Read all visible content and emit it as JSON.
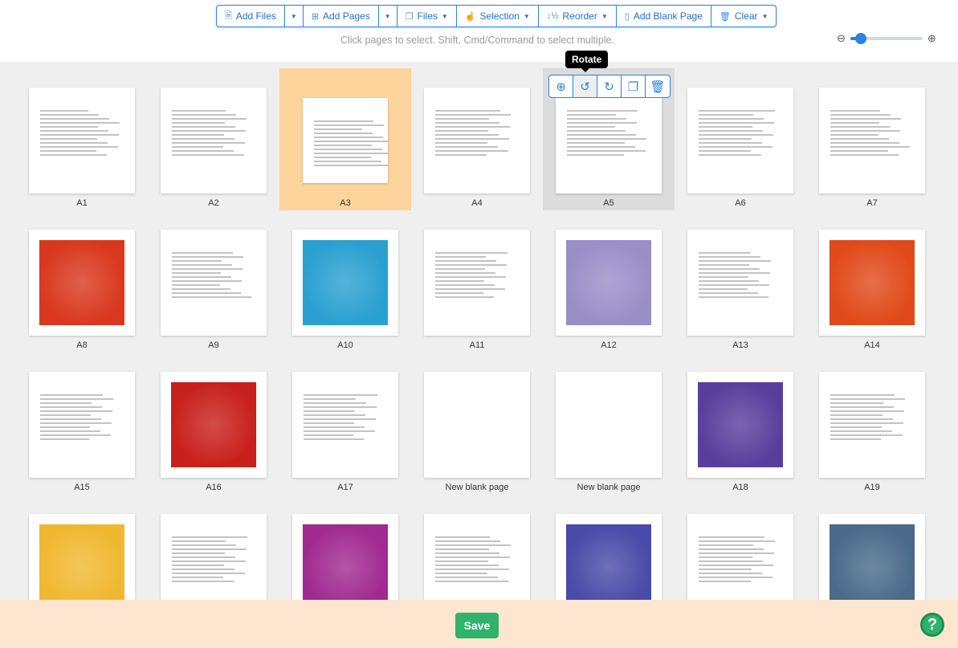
{
  "toolbar": {
    "add_files": "Add Files",
    "add_pages": "Add Pages",
    "files": "Files",
    "selection": "Selection",
    "reorder": "Reorder",
    "add_blank": "Add Blank Page",
    "clear": "Clear"
  },
  "hint": "Click pages to select. Shift, Cmd/Command to select multiple.",
  "zoom_level_percent": 15,
  "tooltip": "Rotate",
  "page_actions": [
    "zoom-in",
    "rotate-left",
    "rotate-right",
    "duplicate",
    "delete"
  ],
  "pages": [
    {
      "label": "A1",
      "type": "text"
    },
    {
      "label": "A2",
      "type": "text"
    },
    {
      "label": "A3",
      "type": "text",
      "selected": true,
      "rotated": true
    },
    {
      "label": "A4",
      "type": "text"
    },
    {
      "label": "A5",
      "type": "text",
      "hovered": true
    },
    {
      "label": "A6",
      "type": "text"
    },
    {
      "label": "A7",
      "type": "text"
    },
    {
      "label": "A8",
      "type": "image",
      "color": "#d9381e"
    },
    {
      "label": "A9",
      "type": "text"
    },
    {
      "label": "A10",
      "type": "image",
      "color": "#2aa0d0"
    },
    {
      "label": "A11",
      "type": "text"
    },
    {
      "label": "A12",
      "type": "image",
      "color": "#9a8ec8"
    },
    {
      "label": "A13",
      "type": "text"
    },
    {
      "label": "A14",
      "type": "image",
      "color": "#e04a1a"
    },
    {
      "label": "A15",
      "type": "text"
    },
    {
      "label": "A16",
      "type": "image",
      "color": "#c8201c"
    },
    {
      "label": "A17",
      "type": "text"
    },
    {
      "label": "New blank page",
      "type": "blank"
    },
    {
      "label": "New blank page",
      "type": "blank"
    },
    {
      "label": "A18",
      "type": "image",
      "color": "#5a3e9c"
    },
    {
      "label": "A19",
      "type": "text"
    },
    {
      "label": "",
      "type": "image",
      "color": "#f0b830"
    },
    {
      "label": "",
      "type": "text"
    },
    {
      "label": "",
      "type": "image",
      "color": "#a02a90"
    },
    {
      "label": "",
      "type": "text"
    },
    {
      "label": "",
      "type": "image",
      "color": "#4a4aa8"
    },
    {
      "label": "",
      "type": "text"
    },
    {
      "label": "",
      "type": "image",
      "color": "#4a6a8a"
    }
  ],
  "footer": {
    "save": "Save",
    "help": "?"
  }
}
